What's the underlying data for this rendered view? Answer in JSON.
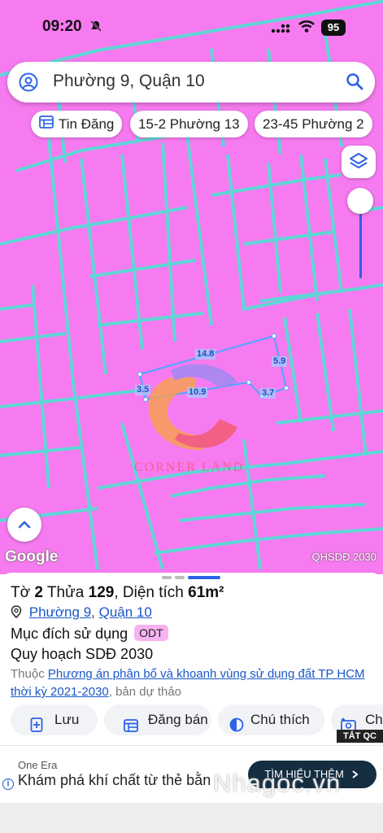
{
  "status": {
    "time": "09:20",
    "battery": "95"
  },
  "search": {
    "text": "Phường 9, Quận 10"
  },
  "chips": [
    {
      "label": "Tin Đăng"
    },
    {
      "label": "15-2 Phường 13"
    },
    {
      "label": "23-45 Phường 2"
    }
  ],
  "map": {
    "dimensions": [
      "14.8",
      "5.9",
      "3.5",
      "10.9",
      "3.7"
    ],
    "watermark": "CORNER LAND",
    "google": "Google",
    "layer_label": "QHSDĐ 2030"
  },
  "sheet": {
    "title_prefix": "Tờ ",
    "sheet_no": "2",
    "parcel_label": " Thửa ",
    "parcel_no": "129",
    "area_label": ", Diện tích ",
    "area_value": "61m²",
    "ward": "Phường 9",
    "district": "Quận 10",
    "purpose_label": "Mục đích sử dụng",
    "purpose_code": "ODT",
    "plan": "Quy hoạch SDĐ 2030",
    "note_prefix": "Thuộc ",
    "note_link": "Phương án phân bổ và khoanh vùng sử dụng đất TP HCM thời kỳ 2021-2030",
    "note_suffix": ", bản dự thảo",
    "actions": [
      {
        "label": "Lưu"
      },
      {
        "label": "Đăng bán"
      },
      {
        "label": "Chú thích"
      },
      {
        "label": "Ch"
      }
    ]
  },
  "ad": {
    "close_label": "TẮT QC",
    "brand": "One Era",
    "headline": "Khám phá khí chất từ thẻ bằn",
    "cta": "TÌM HIỂU THÊM",
    "watermark": "Nhagoc.vn"
  },
  "colors": {
    "map_bg": "#f77bf0",
    "parcel_line": "#5fd6d6",
    "accent": "#1a56c8"
  }
}
